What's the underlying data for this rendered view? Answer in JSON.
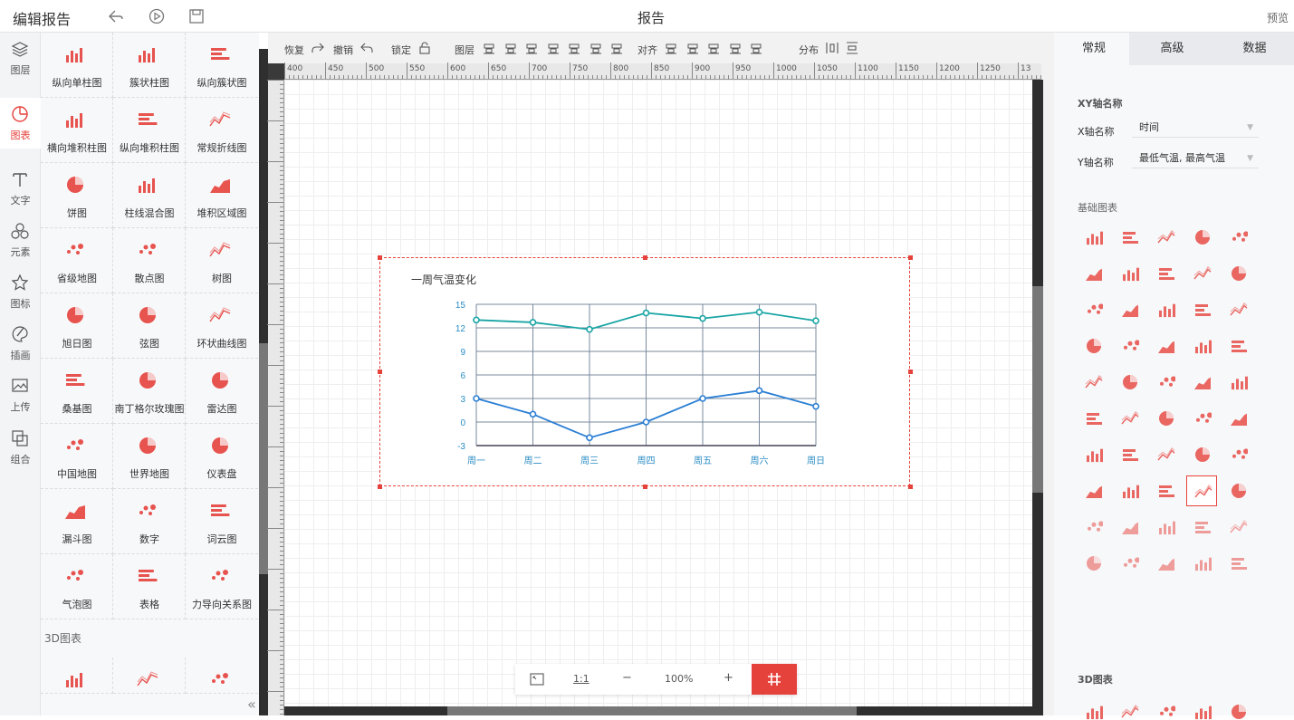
{
  "topbar": {
    "title": "编辑报告",
    "center_title": "报告",
    "preview": "预览"
  },
  "leftnav": [
    {
      "label": "图层",
      "icon": "layers-icon"
    },
    {
      "label": "图表",
      "icon": "chart-icon"
    },
    {
      "label": "文字",
      "icon": "text-icon"
    },
    {
      "label": "元素",
      "icon": "elements-icon"
    },
    {
      "label": "图标",
      "icon": "star-icon"
    },
    {
      "label": "插画",
      "icon": "palette-icon"
    },
    {
      "label": "上传",
      "icon": "upload-icon"
    },
    {
      "label": "组合",
      "icon": "group-icon"
    }
  ],
  "palette": {
    "items": [
      "纵向单柱图",
      "簇状柱图",
      "纵向簇状图",
      "横向堆积柱图",
      "纵向堆积柱图",
      "常规折线图",
      "饼图",
      "柱线混合图",
      "堆积区域图",
      "省级地图",
      "散点图",
      "树图",
      "旭日图",
      "弦图",
      "环状曲线图",
      "桑基图",
      "南丁格尔玫瑰图",
      "雷达图",
      "中国地图",
      "世界地图",
      "仪表盘",
      "漏斗图",
      "数字",
      "词云图",
      "气泡图",
      "表格",
      "力导向关系图"
    ],
    "section_3d": "3D图表"
  },
  "toolbar": {
    "restore": "恢复",
    "undo": "撤销",
    "lock": "锁定",
    "layer": "图层",
    "align": "对齐",
    "distribute": "分布"
  },
  "ruler": {
    "marks": [
      "400",
      "450",
      "500",
      "550",
      "600",
      "650",
      "700",
      "750",
      "800",
      "850",
      "900",
      "950",
      "1000",
      "1050",
      "1100",
      "1150",
      "1200",
      "1250",
      "13"
    ]
  },
  "zoom": {
    "ratio": "1:1",
    "minus": "−",
    "level": "100%",
    "plus": "+"
  },
  "chart_data": {
    "type": "line",
    "title": "一周气温变化",
    "categories": [
      "周一",
      "周二",
      "周三",
      "周四",
      "周五",
      "周六",
      "周日"
    ],
    "series": [
      {
        "values": [
          13,
          12.7,
          11.8,
          13.9,
          13.2,
          14,
          12.9
        ],
        "color": "#1aa5a5"
      },
      {
        "values": [
          3,
          1,
          -2,
          0,
          3,
          4,
          2
        ],
        "color": "#2b7fd4"
      }
    ],
    "yticks": [
      "15",
      "12",
      "9",
      "6",
      "3",
      "0",
      "-3"
    ],
    "ylim": [
      -3,
      15
    ],
    "grid": true
  },
  "rightpanel": {
    "tabs": [
      "常规",
      "高级",
      "数据"
    ],
    "axis_section": "XY轴名称",
    "x_label": "X轴名称",
    "x_value": "时间",
    "y_label": "Y轴名称",
    "y_value": "最低气温, 最高气温",
    "basic_section": "基础图表",
    "section_3d": "3D图表",
    "accent": "#e6423c"
  }
}
